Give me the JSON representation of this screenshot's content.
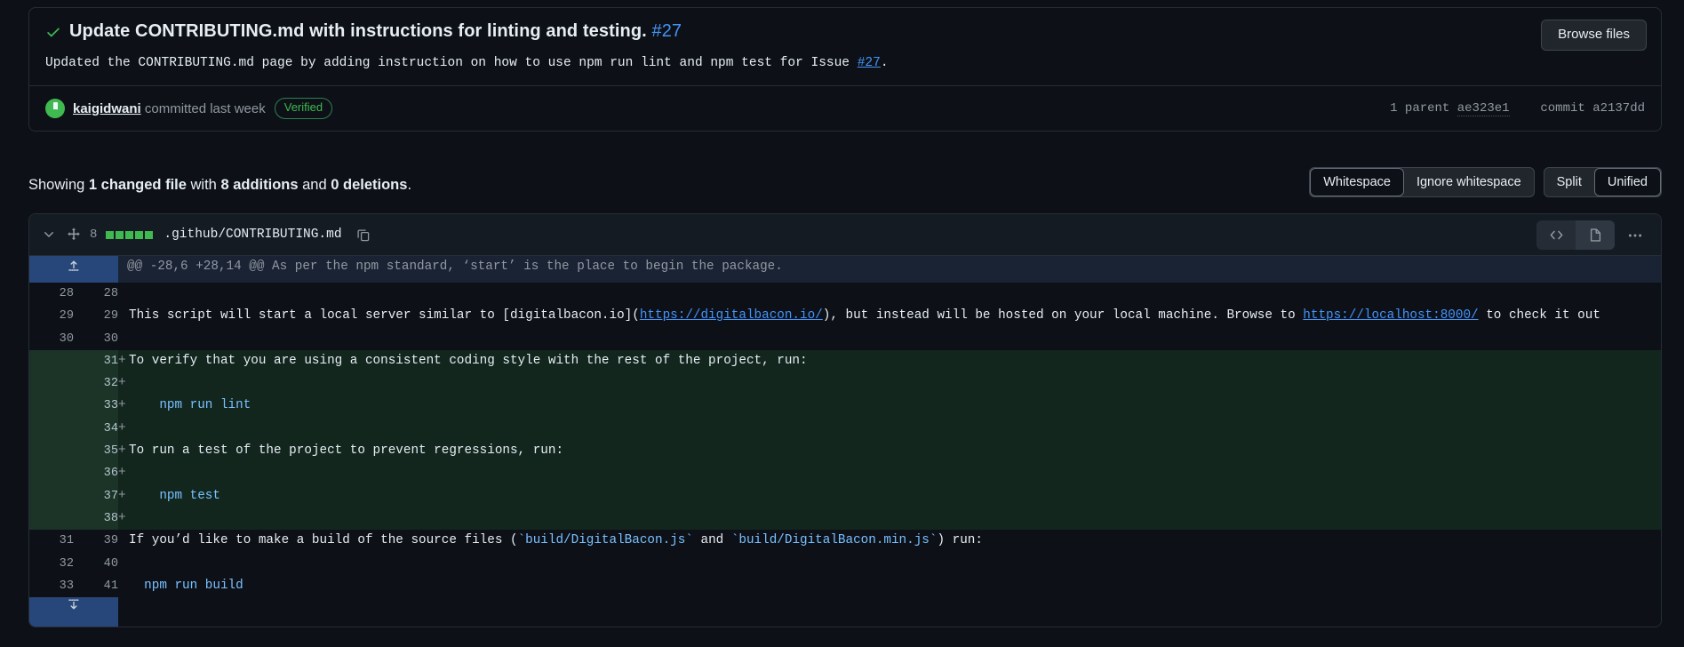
{
  "commit": {
    "status_icon": "check-icon",
    "title": "Update CONTRIBUTING.md with instructions for linting and testing.",
    "issue_ref": "#27",
    "description_parts": {
      "p1": "Updated the ",
      "code1": "CONTRIBUTING.md",
      "p2": " page by adding instruction on how to use ",
      "code2": "npm run lint",
      "p3": " and ",
      "code3": "npm test",
      "p4": " for Issue ",
      "issue_link": "#27",
      "p5": "."
    },
    "browse_files_label": "Browse files",
    "author": "kaigidwani",
    "committed_text": " committed last week",
    "verified_badge": "Verified",
    "parent_label": "1 parent",
    "parent_hash": "ae323e1",
    "commit_label": "commit",
    "commit_hash": "a2137dd"
  },
  "summary": {
    "prefix": "Showing ",
    "files_changed": "1 changed file",
    "mid": " with ",
    "additions": "8 additions",
    "and": " and ",
    "deletions": "0 deletions",
    "suffix": "."
  },
  "diff_options": {
    "whitespace_label": "Whitespace",
    "ignore_whitespace_label": "Ignore whitespace",
    "split_label": "Split",
    "unified_label": "Unified",
    "active_whitespace": "Whitespace",
    "active_view": "Unified"
  },
  "file": {
    "changes_count": "8",
    "stat_squares_filled": 5,
    "stat_squares_total": 5,
    "path": ".github/CONTRIBUTING.md",
    "copy_icon": "copy-icon",
    "collapse_icon": "chevron-down-icon",
    "move_icon": "move-icon",
    "code_view_icon": "code-icon",
    "rendered_view_icon": "file-icon",
    "kebab_icon": "kebab-menu-icon",
    "selected_view": "rendered"
  },
  "hunk": {
    "expand_up_icon": "expand-up-icon",
    "header": "@@ -28,6 +28,14 @@ As per the npm standard, ‘start’ is the place to begin the package.",
    "expand_down_icon": "expand-down-icon"
  },
  "diff_lines": [
    {
      "type": "ctx",
      "old": "28",
      "new": "28",
      "marker": "",
      "text": ""
    },
    {
      "type": "ctx",
      "old": "29",
      "new": "29",
      "marker": "",
      "segments": [
        {
          "t": "text",
          "v": "This script will start a local server similar to [digitalbacon.io]("
        },
        {
          "t": "link",
          "v": "https://digitalbacon.io/"
        },
        {
          "t": "text",
          "v": "), but instead will be hosted on your local machine. Browse to "
        },
        {
          "t": "link",
          "v": "https://localhost:8000/"
        },
        {
          "t": "text",
          "v": " to check it out"
        }
      ]
    },
    {
      "type": "ctx",
      "old": "30",
      "new": "30",
      "marker": "",
      "text": ""
    },
    {
      "type": "add",
      "old": "",
      "new": "31",
      "marker": "+",
      "segments": [
        {
          "t": "text",
          "v": "To verify that you are using a consistent coding style with the rest of the project, run:"
        }
      ]
    },
    {
      "type": "add",
      "old": "",
      "new": "32",
      "marker": "+",
      "segments": []
    },
    {
      "type": "add",
      "old": "",
      "new": "33",
      "marker": "+",
      "segments": [
        {
          "t": "code",
          "v": "    npm run lint"
        }
      ]
    },
    {
      "type": "add",
      "old": "",
      "new": "34",
      "marker": "+",
      "segments": []
    },
    {
      "type": "add",
      "old": "",
      "new": "35",
      "marker": "+",
      "segments": [
        {
          "t": "text",
          "v": "To run a test of the project to prevent regressions, run:"
        }
      ]
    },
    {
      "type": "add",
      "old": "",
      "new": "36",
      "marker": "+",
      "segments": []
    },
    {
      "type": "add",
      "old": "",
      "new": "37",
      "marker": "+",
      "segments": [
        {
          "t": "code",
          "v": "    npm test"
        }
      ]
    },
    {
      "type": "add",
      "old": "",
      "new": "38",
      "marker": "+",
      "segments": []
    },
    {
      "type": "ctx",
      "old": "31",
      "new": "39",
      "marker": "",
      "segments": [
        {
          "t": "text",
          "v": "If you’d like to make a build of the source files ("
        },
        {
          "t": "code",
          "v": "`build/DigitalBacon.js`"
        },
        {
          "t": "text",
          "v": " and "
        },
        {
          "t": "code",
          "v": "`build/DigitalBacon.min.js`"
        },
        {
          "t": "text",
          "v": ") run:"
        }
      ]
    },
    {
      "type": "ctx",
      "old": "32",
      "new": "40",
      "marker": "",
      "segments": []
    },
    {
      "type": "ctx",
      "old": "33",
      "new": "41",
      "marker": "",
      "segments": [
        {
          "t": "code",
          "v": "  npm run build"
        }
      ]
    }
  ],
  "colors": {
    "background": "#0d1117",
    "addition_bg": "#12261e",
    "addition_gutter": "#1c3327",
    "accent_blue": "#4493f8",
    "green": "#3fb950",
    "hunk_blue": "#27477a"
  }
}
